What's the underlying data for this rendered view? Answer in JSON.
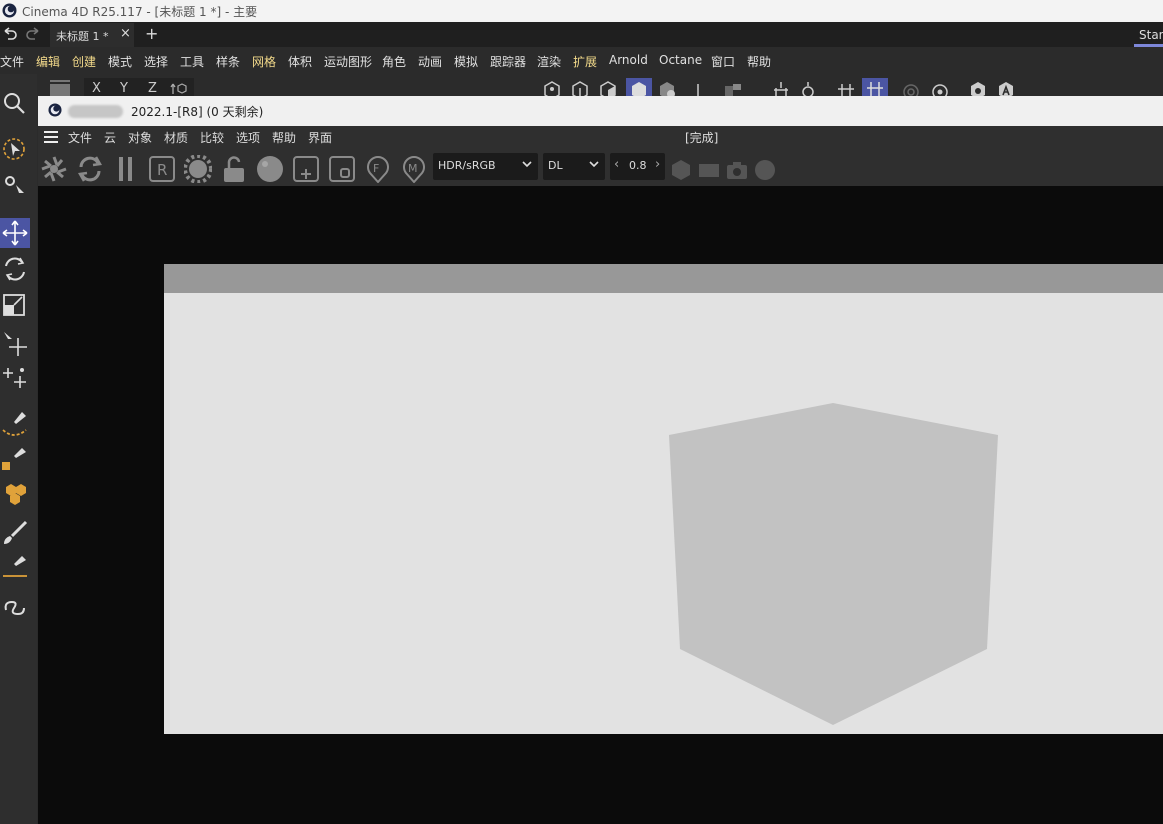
{
  "app": {
    "window_title": "Cinema 4D R25.117 - [未标题 1 *] - 主要"
  },
  "tabs": {
    "document_tab": "未标题 1 *",
    "close_glyph": "×",
    "add_glyph": "+",
    "layout_label": "Standard"
  },
  "menu": {
    "items": [
      {
        "label": "文件"
      },
      {
        "label": "编辑"
      },
      {
        "label": "创建"
      },
      {
        "label": "模式"
      },
      {
        "label": "选择"
      },
      {
        "label": "工具"
      },
      {
        "label": "样条"
      },
      {
        "label": "网格"
      },
      {
        "label": "体积"
      },
      {
        "label": "运动图形"
      },
      {
        "label": "角色"
      },
      {
        "label": "动画"
      },
      {
        "label": "模拟"
      },
      {
        "label": "跟踪器"
      },
      {
        "label": "渲染"
      },
      {
        "label": "扩展"
      },
      {
        "label": "Arnold"
      },
      {
        "label": "Octane"
      },
      {
        "label": "窗口"
      },
      {
        "label": "帮助"
      }
    ],
    "highlight_color": "#f2d98a"
  },
  "axis_lock": {
    "x": "X",
    "y": "Y",
    "z": "Z"
  },
  "render_window": {
    "title": "2022.1-[R8] (0 天剩余)",
    "status": "[完成]",
    "menu": [
      {
        "label": "文件"
      },
      {
        "label": "云"
      },
      {
        "label": "对象"
      },
      {
        "label": "材质"
      },
      {
        "label": "比较"
      },
      {
        "label": "选项"
      },
      {
        "label": "帮助"
      },
      {
        "label": "界面"
      }
    ],
    "colorspace": "HDR/sRGB",
    "kernel": "DL",
    "value": "0.8",
    "dec_glyph": "‹",
    "inc_glyph": "›"
  },
  "colors": {
    "accent": "#4b55a3",
    "render_background": "#e2e2e2",
    "cube": "#c2c2c2"
  }
}
